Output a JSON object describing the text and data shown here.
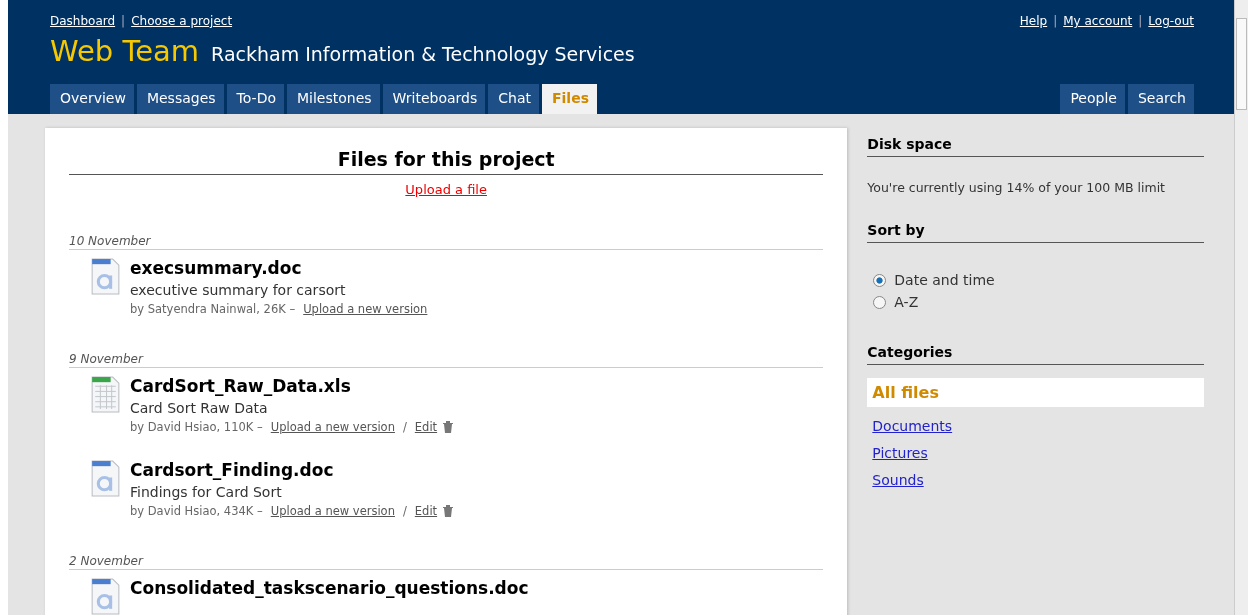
{
  "top_links_left": [
    "Dashboard",
    "Choose a project"
  ],
  "top_links_right": [
    "Help",
    "My account",
    "Log-out"
  ],
  "top_links_separator": "|",
  "file_links_separator": "/",
  "project": {
    "name": "Web Team",
    "company": "Rackham Information & Technology Services"
  },
  "tabs": [
    {
      "label": "Overview",
      "selected": false
    },
    {
      "label": "Messages",
      "selected": false
    },
    {
      "label": "To-Do",
      "selected": false
    },
    {
      "label": "Milestones",
      "selected": false
    },
    {
      "label": "Writeboards",
      "selected": false
    },
    {
      "label": "Chat",
      "selected": false
    },
    {
      "label": "Files",
      "selected": true
    }
  ],
  "right_tabs": [
    {
      "label": "People",
      "selected": false
    },
    {
      "label": "Search",
      "selected": false
    }
  ],
  "main": {
    "title": "Files for this project",
    "upload_link": "Upload a file",
    "groups": [
      {
        "date": "10 November",
        "files": [
          {
            "kind": "doc",
            "name": "execsummary.doc",
            "description": "executive summary for carsort",
            "meta": "by Satyendra Nainwal, 26K –",
            "links": [
              "Upload a new version"
            ],
            "deletable": false
          }
        ]
      },
      {
        "date": "9 November",
        "files": [
          {
            "kind": "xls",
            "name": "CardSort_Raw_Data.xls",
            "description": "Card Sort Raw Data",
            "meta": "by David Hsiao, 110K –",
            "links": [
              "Upload a new version",
              "Edit"
            ],
            "deletable": true
          },
          {
            "kind": "doc",
            "name": "Cardsort_Finding.doc",
            "description": "Findings for Card Sort",
            "meta": "by David Hsiao, 434K –",
            "links": [
              "Upload a new version",
              "Edit"
            ],
            "deletable": true
          }
        ]
      },
      {
        "date": "2 November",
        "files": [
          {
            "kind": "doc",
            "name": "Consolidated_taskscenario_questions.doc"
          }
        ]
      }
    ]
  },
  "sidebar": {
    "disk_title": "Disk space",
    "disk_text": "You're currently using 14% of your 100 MB limit",
    "sort_title": "Sort by",
    "sort_options": [
      {
        "label": "Date and time",
        "selected": true
      },
      {
        "label": "A-Z",
        "selected": false
      }
    ],
    "categories_title": "Categories",
    "categories": [
      {
        "label": "All files",
        "selected": true
      },
      {
        "label": "Documents",
        "selected": false
      },
      {
        "label": "Pictures",
        "selected": false
      },
      {
        "label": "Sounds",
        "selected": false
      }
    ]
  }
}
